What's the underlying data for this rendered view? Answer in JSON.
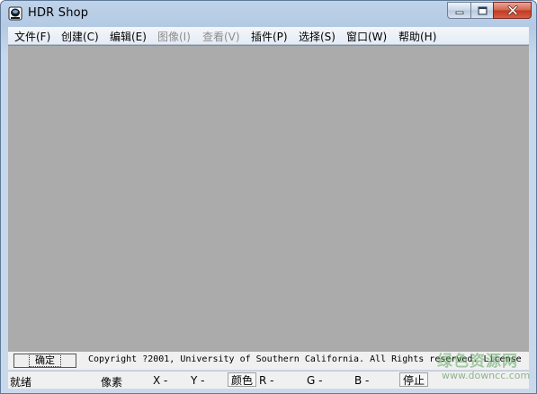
{
  "window": {
    "title": "HDR Shop",
    "icon": "hdr-shop-app-icon"
  },
  "menu": [
    {
      "label": "文件(F)",
      "enabled": true
    },
    {
      "label": "创建(C)",
      "enabled": true
    },
    {
      "label": "编辑(E)",
      "enabled": true
    },
    {
      "label": "图像(I)",
      "enabled": false
    },
    {
      "label": "查看(V)",
      "enabled": false
    },
    {
      "label": "插件(P)",
      "enabled": true
    },
    {
      "label": "选择(S)",
      "enabled": true
    },
    {
      "label": "窗口(W)",
      "enabled": true
    },
    {
      "label": "帮助(H)",
      "enabled": true
    }
  ],
  "command": {
    "button_label": "确定",
    "copyright": "Copyright ?2001, University of Southern California.  All Rights reserved.  License"
  },
  "status": {
    "ready": "就绪",
    "pixel": "像素",
    "x": "X -",
    "y": "Y -",
    "color": "颜色",
    "r": "R -",
    "g": "G -",
    "b": "B -",
    "stop": "停止"
  },
  "watermark": {
    "text": "绿色资源网",
    "url": "www.downcc.com"
  },
  "colors": {
    "workspace": "#ababab",
    "close_button": "#c8402a",
    "frame": "#bfd3ea"
  }
}
